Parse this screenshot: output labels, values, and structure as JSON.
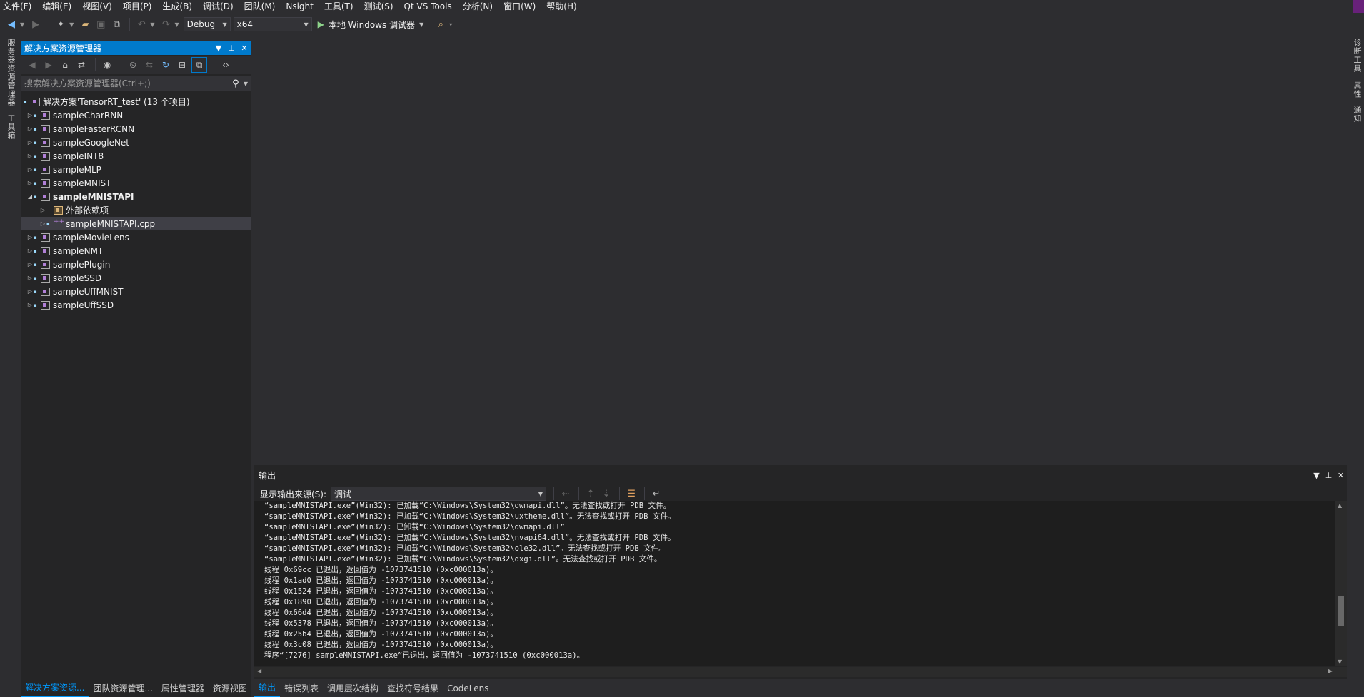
{
  "menu": [
    "文件(F)",
    "编辑(E)",
    "视图(V)",
    "项目(P)",
    "生成(B)",
    "调试(D)",
    "团队(M)",
    "Nsight",
    "工具(T)",
    "测试(S)",
    "Qt VS Tools",
    "分析(N)",
    "窗口(W)",
    "帮助(H)"
  ],
  "window": {
    "minimize": "——"
  },
  "toolbar": {
    "config": "Debug",
    "platform": "x64",
    "run_label": "本地 Windows 调试器"
  },
  "left_vertical_tabs": [
    "服务器资源管理器",
    "工具箱"
  ],
  "right_vertical_tabs": [
    "诊断工具",
    "属性",
    "通知"
  ],
  "solution_explorer": {
    "title": "解决方案资源管理器",
    "search_placeholder": "搜索解决方案资源管理器(Ctrl+;)",
    "root": "解决方案'TensorRT_test' (13 个项目)",
    "items": [
      {
        "label": "sampleCharRNN",
        "level": 1,
        "expanded": false,
        "bold": false
      },
      {
        "label": "sampleFasterRCNN",
        "level": 1,
        "expanded": false,
        "bold": false
      },
      {
        "label": "sampleGoogleNet",
        "level": 1,
        "expanded": false,
        "bold": false
      },
      {
        "label": "sampleINT8",
        "level": 1,
        "expanded": false,
        "bold": false
      },
      {
        "label": "sampleMLP",
        "level": 1,
        "expanded": false,
        "bold": false
      },
      {
        "label": "sampleMNIST",
        "level": 1,
        "expanded": false,
        "bold": false
      },
      {
        "label": "sampleMNISTAPI",
        "level": 1,
        "expanded": true,
        "bold": true
      },
      {
        "label": "外部依赖项",
        "level": 2,
        "expanded": false,
        "bold": false
      },
      {
        "label": "sampleMNISTAPI.cpp",
        "level": 2,
        "expanded": false,
        "bold": false,
        "selected": true
      },
      {
        "label": "sampleMovieLens",
        "level": 1,
        "expanded": false,
        "bold": false
      },
      {
        "label": "sampleNMT",
        "level": 1,
        "expanded": false,
        "bold": false
      },
      {
        "label": "samplePlugin",
        "level": 1,
        "expanded": false,
        "bold": false
      },
      {
        "label": "sampleSSD",
        "level": 1,
        "expanded": false,
        "bold": false
      },
      {
        "label": "sampleUffMNIST",
        "level": 1,
        "expanded": false,
        "bold": false
      },
      {
        "label": "sampleUffSSD",
        "level": 1,
        "expanded": false,
        "bold": false
      }
    ]
  },
  "left_bottom_tabs": [
    "解决方案资源...",
    "团队资源管理...",
    "属性管理器",
    "资源视图"
  ],
  "output": {
    "title": "输出",
    "source_label": "显示输出来源(S):",
    "source_value": "调试",
    "lines": [
      "“sampleMNISTAPI.exe”(Win32): 已加载“C:\\Windows\\System32\\dwmapi.dll”。无法查找或打开 PDB 文件。",
      "“sampleMNISTAPI.exe”(Win32): 已加载“C:\\Windows\\System32\\uxtheme.dll”。无法查找或打开 PDB 文件。",
      "“sampleMNISTAPI.exe”(Win32): 已卸载“C:\\Windows\\System32\\dwmapi.dll”",
      "“sampleMNISTAPI.exe”(Win32): 已加载“C:\\Windows\\System32\\nvapi64.dll”。无法查找或打开 PDB 文件。",
      "“sampleMNISTAPI.exe”(Win32): 已加载“C:\\Windows\\System32\\ole32.dll”。无法查找或打开 PDB 文件。",
      "“sampleMNISTAPI.exe”(Win32): 已加载“C:\\Windows\\System32\\dxgi.dll”。无法查找或打开 PDB 文件。",
      "线程 0x69cc 已退出，返回值为 -1073741510 (0xc000013a)。",
      "线程 0x1ad0 已退出，返回值为 -1073741510 (0xc000013a)。",
      "线程 0x1524 已退出，返回值为 -1073741510 (0xc000013a)。",
      "线程 0x1890 已退出，返回值为 -1073741510 (0xc000013a)。",
      "线程 0x66d4 已退出，返回值为 -1073741510 (0xc000013a)。",
      "线程 0x5378 已退出，返回值为 -1073741510 (0xc000013a)。",
      "线程 0x25b4 已退出，返回值为 -1073741510 (0xc000013a)。",
      "线程 0x3c08 已退出，返回值为 -1073741510 (0xc000013a)。",
      "程序“[7276] sampleMNISTAPI.exe”已退出，返回值为 -1073741510 (0xc000013a)。"
    ]
  },
  "bottom_tabs": [
    "输出",
    "错误列表",
    "调用层次结构",
    "查找符号结果",
    "CodeLens"
  ],
  "colors": {
    "accent": "#007acc",
    "background": "#2d2d30",
    "panel": "#252526",
    "editor": "#1e1e1e",
    "tab_active": "#0097fb"
  }
}
